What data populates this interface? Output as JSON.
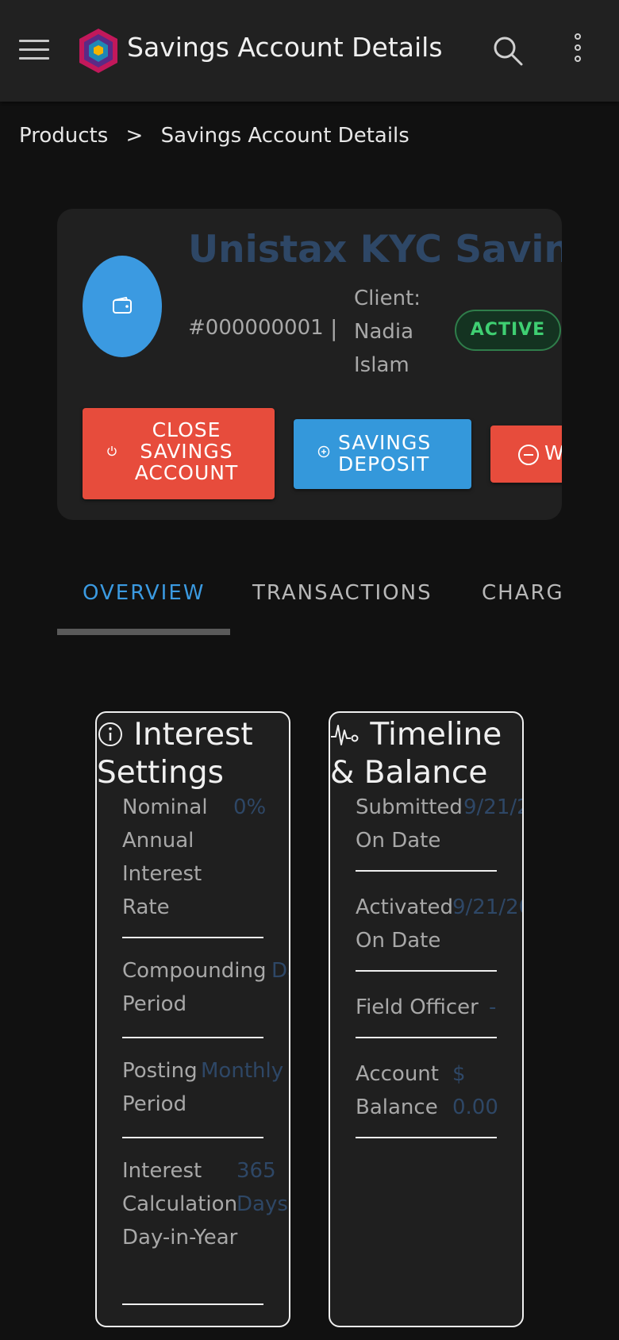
{
  "app_bar": {
    "title": "Savings Account Details"
  },
  "breadcrumb": {
    "items": [
      "Products",
      "Savings Account Details"
    ],
    "separator": ">"
  },
  "account": {
    "name": "Unistax KYC Savings",
    "number": "#000000001",
    "separator": "|",
    "client_label": "Client:",
    "client_name": "Nadia Islam",
    "status": "ACTIVE"
  },
  "actions": {
    "close_label": "CLOSE SAVINGS ACCOUNT",
    "deposit_label": "SAVINGS DEPOSIT",
    "withdraw_label": "W"
  },
  "tabs": [
    {
      "label": "OVERVIEW",
      "active": true
    },
    {
      "label": "TRANSACTIONS",
      "active": false
    },
    {
      "label": "CHARG",
      "active": false
    }
  ],
  "interest_settings": {
    "title": "Interest Settings",
    "rows": [
      {
        "label": "Nominal Annual Interest Rate",
        "value": "0%"
      },
      {
        "label": "Compounding Period",
        "value": "Da"
      },
      {
        "label": "Posting Period",
        "value": "Monthly"
      },
      {
        "label": "Interest Calculation Day-in-Year",
        "value": "365 Days"
      }
    ]
  },
  "timeline": {
    "title": "Timeline & Balance",
    "rows": [
      {
        "label": "Submitted On Date",
        "value": "9/21/2"
      },
      {
        "label": "Activated On Date",
        "value": "9/21/20"
      },
      {
        "label": "Field Officer",
        "value": "-"
      },
      {
        "label": "Account Balance",
        "value": "$ 0.00"
      }
    ]
  },
  "colors": {
    "app_bar": "#212121",
    "background": "#111111",
    "card": "#202020",
    "primary": "#3b9ae1",
    "danger": "#e74c3c",
    "success": "#3fcf72",
    "muted_value": "#2e4766"
  }
}
